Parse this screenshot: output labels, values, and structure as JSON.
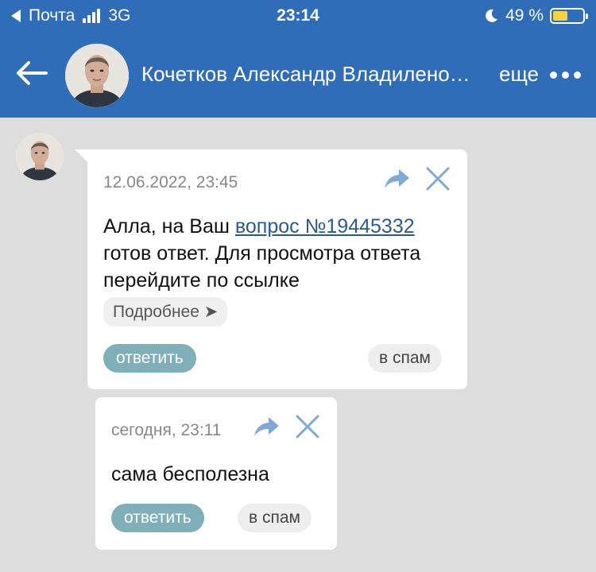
{
  "status_bar": {
    "carrier": "Почта",
    "network": "3G",
    "time": "23:14",
    "battery": "49 %",
    "battery_level": 0.49,
    "battery_color": "#f5d33b"
  },
  "header": {
    "contact_name": "Кочетков Александр Владилено…",
    "more_label": "еще",
    "background": "#2f6db8"
  },
  "messages": [
    {
      "time": "12.06.2022, 23:45",
      "text_before": "Алла, на Ваш ",
      "link": "вопрос №19445332",
      "text_after": " готов ответ. Для просмотра ответа перейдите по ссылке",
      "more_button": "Подробнее ➤",
      "reply_button": "ответить",
      "spam_button": "в спам"
    },
    {
      "time": "сегодня, 23:11",
      "text": "сама бесполезна",
      "reply_button": "ответить",
      "spam_button": "в спам"
    }
  ],
  "icons": [
    "back-arrow-icon",
    "forward-icon",
    "close-icon",
    "more-dots-icon",
    "moon-icon",
    "signal-icon"
  ],
  "colors": {
    "accent": "#2f6db8",
    "reply": "#7fb0ba",
    "link": "#2a5a8f"
  }
}
